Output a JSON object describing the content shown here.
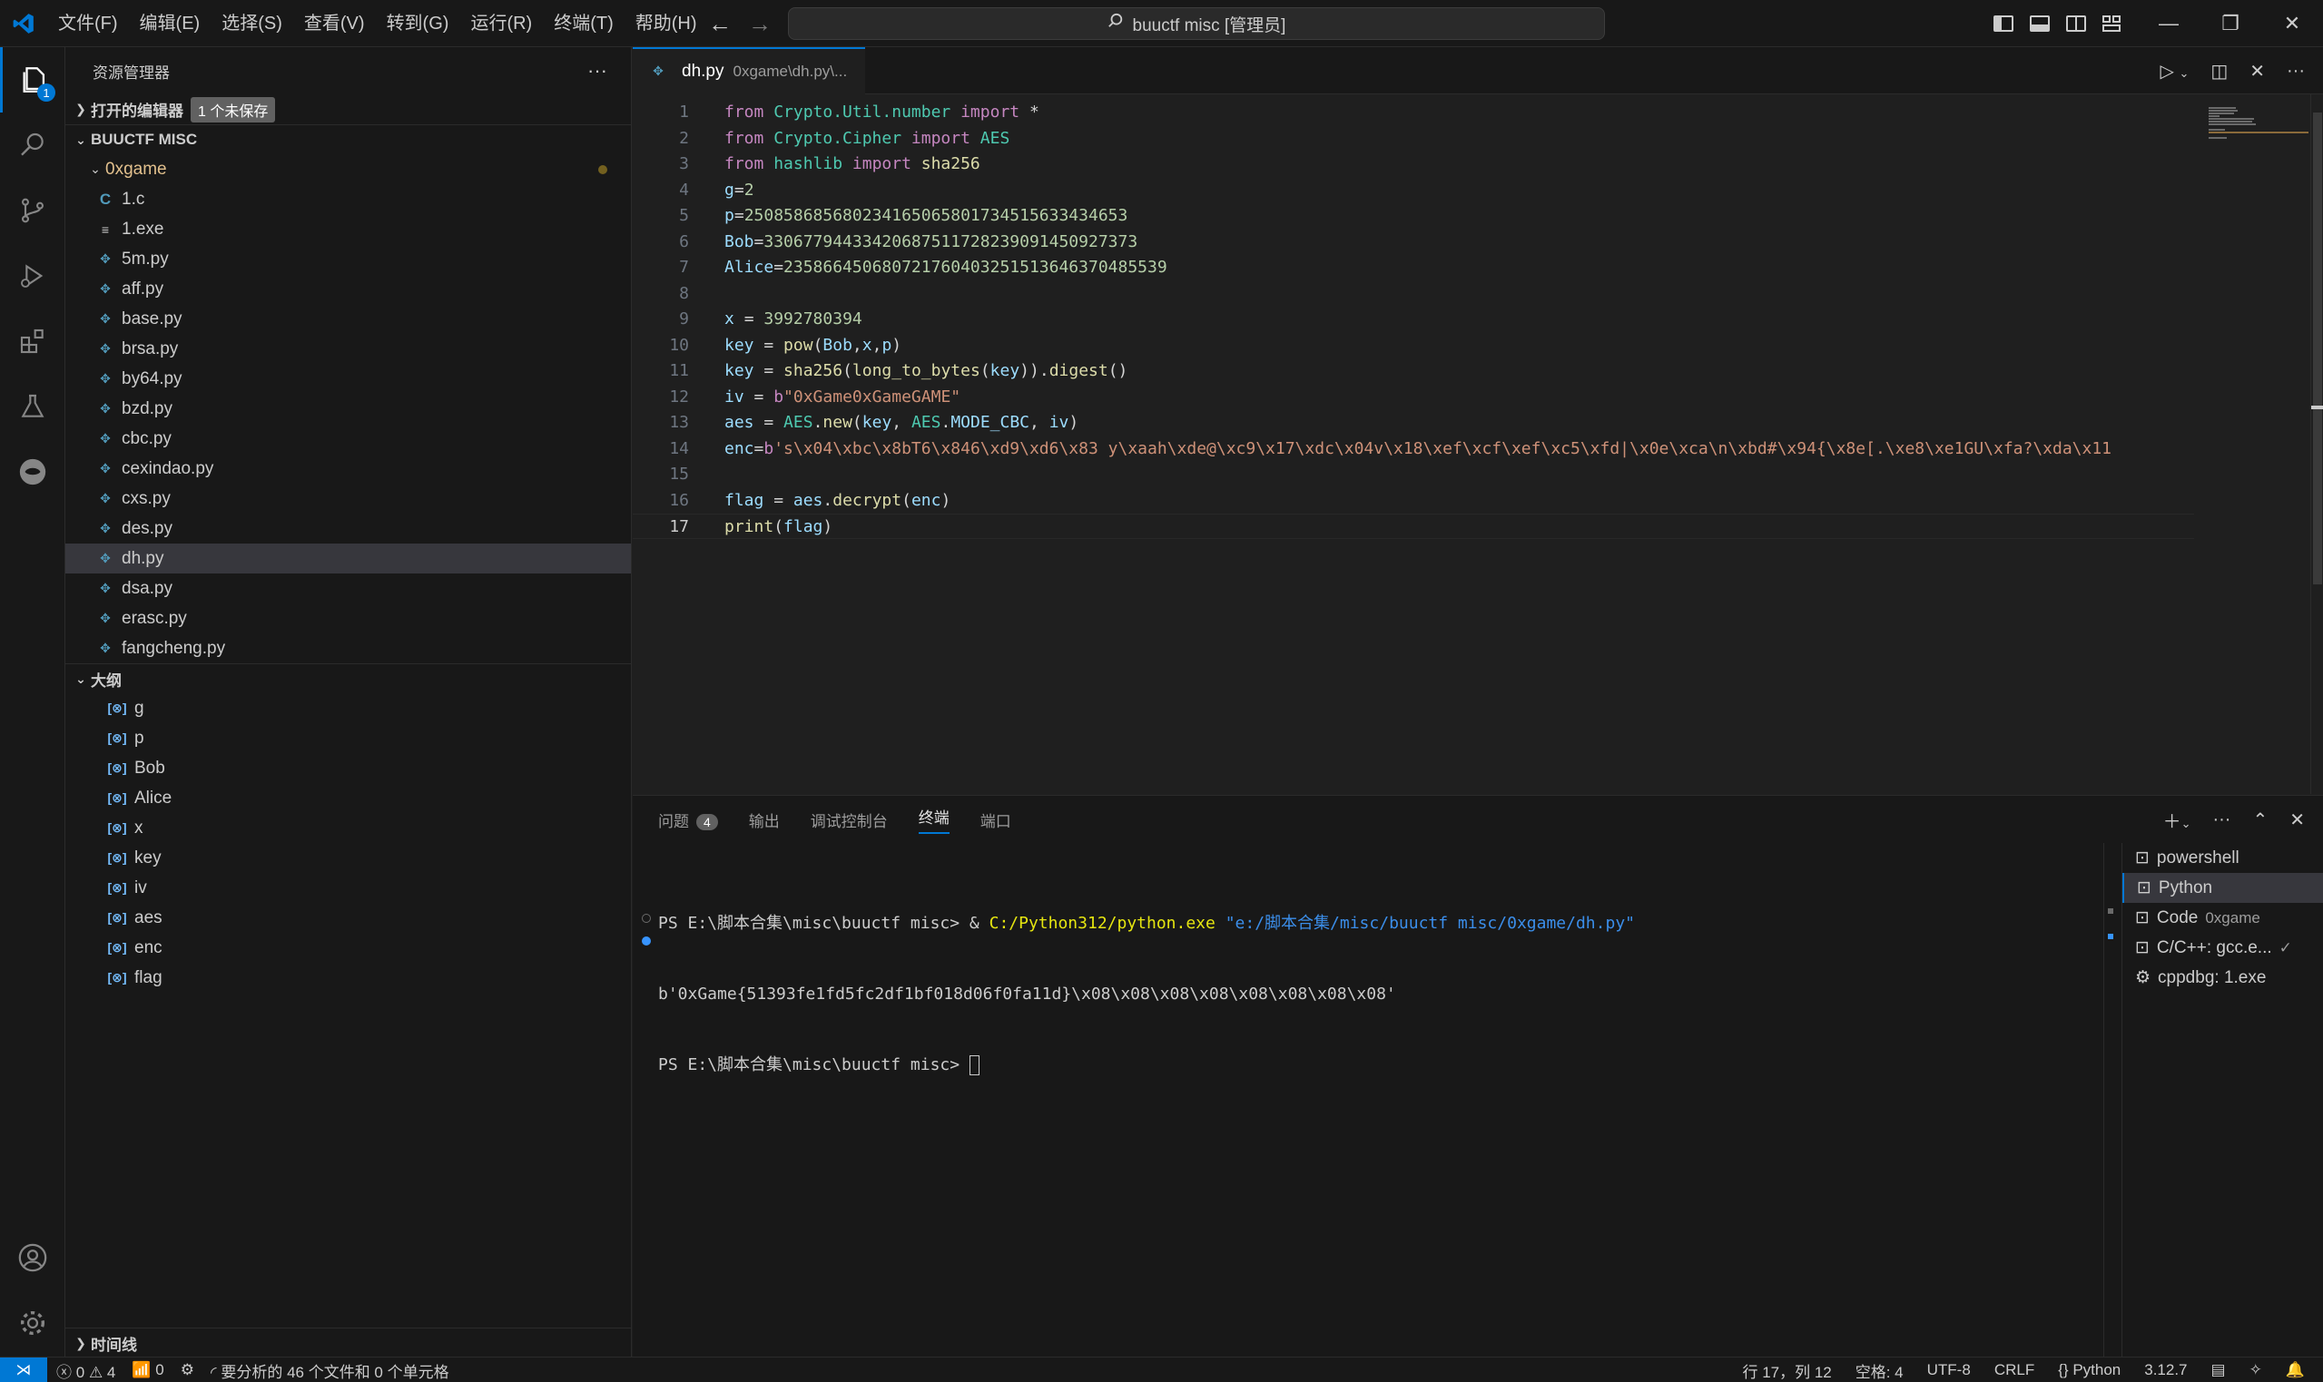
{
  "titlebar": {
    "menus": [
      "文件(F)",
      "编辑(E)",
      "选择(S)",
      "查看(V)",
      "转到(G)",
      "运行(R)",
      "终端(T)",
      "帮助(H)"
    ],
    "search_text": "buuctf misc [管理员]"
  },
  "activitybar": {
    "explorer_badge": "1"
  },
  "sidebar": {
    "title": "资源管理器",
    "open_editors_label": "打开的编辑器",
    "unsaved_badge": "1 个未保存",
    "workspace_label": "BUUCTF MISC",
    "folder_label": "0xgame",
    "files": [
      {
        "name": "1.c",
        "type": "c"
      },
      {
        "name": "1.exe",
        "type": "exe"
      },
      {
        "name": "5m.py",
        "type": "py"
      },
      {
        "name": "aff.py",
        "type": "py"
      },
      {
        "name": "base.py",
        "type": "py"
      },
      {
        "name": "brsa.py",
        "type": "py"
      },
      {
        "name": "by64.py",
        "type": "py"
      },
      {
        "name": "bzd.py",
        "type": "py"
      },
      {
        "name": "cbc.py",
        "type": "py"
      },
      {
        "name": "cexindao.py",
        "type": "py"
      },
      {
        "name": "cxs.py",
        "type": "py"
      },
      {
        "name": "des.py",
        "type": "py"
      },
      {
        "name": "dh.py",
        "type": "py",
        "selected": true
      },
      {
        "name": "dsa.py",
        "type": "py"
      },
      {
        "name": "erasc.py",
        "type": "py"
      },
      {
        "name": "fangcheng.py",
        "type": "py"
      }
    ],
    "outline_label": "大纲",
    "outline_items": [
      "g",
      "p",
      "Bob",
      "Alice",
      "x",
      "key",
      "iv",
      "aes",
      "enc",
      "flag"
    ],
    "timeline_label": "时间线"
  },
  "editor": {
    "tab_name": "dh.py",
    "tab_path": "0xgame\\dh.py\\...",
    "current_line": "17",
    "lines": [
      {
        "n": "1",
        "t": [
          [
            "kw",
            "from "
          ],
          [
            "mod",
            "Crypto.Util.number "
          ],
          [
            "kw",
            "import "
          ],
          [
            "op",
            "*"
          ]
        ]
      },
      {
        "n": "2",
        "t": [
          [
            "kw",
            "from "
          ],
          [
            "mod",
            "Crypto.Cipher "
          ],
          [
            "kw",
            "import "
          ],
          [
            "mod",
            "AES"
          ]
        ]
      },
      {
        "n": "3",
        "t": [
          [
            "kw",
            "from "
          ],
          [
            "mod",
            "hashlib "
          ],
          [
            "kw",
            "import "
          ],
          [
            "fn",
            "sha256"
          ]
        ]
      },
      {
        "n": "4",
        "t": [
          [
            "var",
            "g"
          ],
          [
            "op",
            "="
          ],
          [
            "num",
            "2"
          ]
        ]
      },
      {
        "n": "5",
        "t": [
          [
            "var",
            "p"
          ],
          [
            "op",
            "="
          ],
          [
            "num",
            "250858685680234165065801734515633434653"
          ]
        ]
      },
      {
        "n": "6",
        "t": [
          [
            "var",
            "Bob"
          ],
          [
            "op",
            "="
          ],
          [
            "num",
            "33067794433420687511728239091450927373"
          ]
        ]
      },
      {
        "n": "7",
        "t": [
          [
            "var",
            "Alice"
          ],
          [
            "op",
            "="
          ],
          [
            "num",
            "235866450680721760403251513646370485539"
          ]
        ]
      },
      {
        "n": "8",
        "t": []
      },
      {
        "n": "9",
        "t": [
          [
            "var",
            "x "
          ],
          [
            "op",
            "= "
          ],
          [
            "num",
            "3992780394"
          ]
        ]
      },
      {
        "n": "10",
        "t": [
          [
            "var",
            "key "
          ],
          [
            "op",
            "= "
          ],
          [
            "fn",
            "pow"
          ],
          [
            "op",
            "("
          ],
          [
            "var",
            "Bob"
          ],
          [
            "op",
            ","
          ],
          [
            "var",
            "x"
          ],
          [
            "op",
            ","
          ],
          [
            "var",
            "p"
          ],
          [
            "op",
            ")"
          ]
        ]
      },
      {
        "n": "11",
        "t": [
          [
            "var",
            "key "
          ],
          [
            "op",
            "= "
          ],
          [
            "fn",
            "sha256"
          ],
          [
            "op",
            "("
          ],
          [
            "fn",
            "long_to_bytes"
          ],
          [
            "op",
            "("
          ],
          [
            "var",
            "key"
          ],
          [
            "op",
            "))."
          ],
          [
            "fn",
            "digest"
          ],
          [
            "op",
            "()"
          ]
        ]
      },
      {
        "n": "12",
        "t": [
          [
            "var",
            "iv "
          ],
          [
            "op",
            "= "
          ],
          [
            "kw",
            "b"
          ],
          [
            "str",
            "\"0xGame0xGameGAME\""
          ]
        ]
      },
      {
        "n": "13",
        "t": [
          [
            "var",
            "aes "
          ],
          [
            "op",
            "= "
          ],
          [
            "mod",
            "AES"
          ],
          [
            "op",
            "."
          ],
          [
            "fn",
            "new"
          ],
          [
            "op",
            "("
          ],
          [
            "var",
            "key"
          ],
          [
            "op",
            ", "
          ],
          [
            "mod",
            "AES"
          ],
          [
            "op",
            "."
          ],
          [
            "var",
            "MODE_CBC"
          ],
          [
            "op",
            ", "
          ],
          [
            "var",
            "iv"
          ],
          [
            "op",
            ")"
          ]
        ]
      },
      {
        "n": "14",
        "t": [
          [
            "var",
            "enc"
          ],
          [
            "op",
            "="
          ],
          [
            "kw",
            "b"
          ],
          [
            "str",
            "'s\\x04\\xbc\\x8bT6\\x846\\xd9\\xd6\\x83 y\\xaah\\xde@\\xc9\\x17\\xdc\\x04v\\x18\\xef\\xcf\\xef\\xc5\\xfd|\\x0e\\xca\\n\\xbd#\\x94{\\x8e[.\\xe8\\xe1GU\\xfa?\\xda\\x11"
          ]
        ]
      },
      {
        "n": "15",
        "t": []
      },
      {
        "n": "16",
        "t": [
          [
            "var",
            "flag "
          ],
          [
            "op",
            "= "
          ],
          [
            "var",
            "aes"
          ],
          [
            "op",
            "."
          ],
          [
            "fn",
            "decrypt"
          ],
          [
            "op",
            "("
          ],
          [
            "var",
            "enc"
          ],
          [
            "op",
            ")"
          ]
        ]
      },
      {
        "n": "17",
        "t": [
          [
            "fn",
            "print"
          ],
          [
            "op",
            "("
          ],
          [
            "var",
            "flag"
          ],
          [
            "op",
            ")"
          ]
        ]
      }
    ]
  },
  "panel": {
    "tabs": [
      "问题",
      "输出",
      "调试控制台",
      "终端",
      "端口"
    ],
    "problems_count": "4",
    "active_tab": "终端",
    "terminal": {
      "line1_prompt": "PS E:\\脚本合集\\misc\\buuctf misc> & ",
      "line1_exe": "C:/Python312/python.exe",
      "line1_arg": " \"e:/脚本合集/misc/buuctf misc/0xgame/dh.py\"",
      "line2": "b'0xGame{51393fe1fd5fc2df1bf018d06f0fa11d}\\x08\\x08\\x08\\x08\\x08\\x08\\x08\\x08'",
      "line3": "PS E:\\脚本合集\\misc\\buuctf misc> "
    },
    "terminal_list": [
      {
        "name": "powershell",
        "sub": ""
      },
      {
        "name": "Python",
        "sub": "",
        "selected": true
      },
      {
        "name": "Code",
        "sub": "0xgame"
      },
      {
        "name": "C/C++: gcc.e...",
        "sub": "✓"
      },
      {
        "name": "cppdbg: 1.exe",
        "sub": ""
      }
    ]
  },
  "statusbar": {
    "errors": "0",
    "warnings": "4",
    "ports": "0",
    "analysis": "要分析的 46 个文件和 0 个单元格",
    "position": "行 17，列 12",
    "spaces": "空格: 4",
    "encoding": "UTF-8",
    "eol": "CRLF",
    "language": "Python",
    "version": "3.12.7"
  },
  "colors": {
    "accent": "#0078d4",
    "background": "#1f1f1f",
    "sidebar": "#181818"
  }
}
